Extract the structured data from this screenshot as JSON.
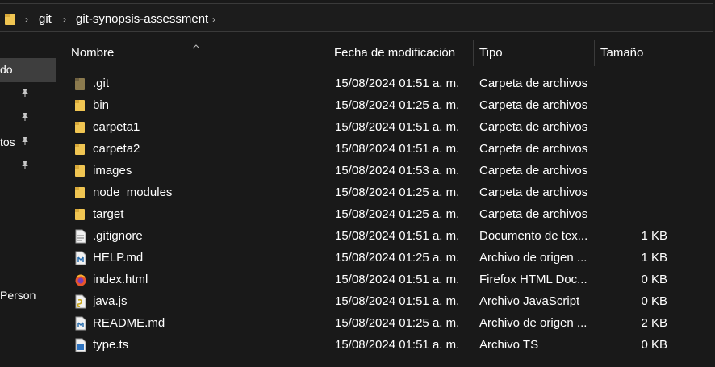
{
  "breadcrumb": {
    "items": [
      "git",
      "git-synopsis-assessment"
    ]
  },
  "nav": {
    "items": [
      {
        "label": "do",
        "selected": true
      },
      {
        "label": "",
        "pinned": true
      },
      {
        "label": "",
        "pinned": true
      },
      {
        "label": "tos",
        "pinned": true
      },
      {
        "label": "",
        "pinned": true
      },
      {
        "label": "Person"
      }
    ]
  },
  "columns": {
    "name": "Nombre",
    "date": "Fecha de modificación",
    "type": "Tipo",
    "size": "Tamaño"
  },
  "files": [
    {
      "name": ".git",
      "date": "15/08/2024 01:51 a. m.",
      "type": "Carpeta de archivos",
      "size": "",
      "icon": "folder-dim-icon"
    },
    {
      "name": "bin",
      "date": "15/08/2024 01:25 a. m.",
      "type": "Carpeta de archivos",
      "size": "",
      "icon": "folder-icon"
    },
    {
      "name": "carpeta1",
      "date": "15/08/2024 01:51 a. m.",
      "type": "Carpeta de archivos",
      "size": "",
      "icon": "folder-icon"
    },
    {
      "name": "carpeta2",
      "date": "15/08/2024 01:51 a. m.",
      "type": "Carpeta de archivos",
      "size": "",
      "icon": "folder-icon"
    },
    {
      "name": "images",
      "date": "15/08/2024 01:53 a. m.",
      "type": "Carpeta de archivos",
      "size": "",
      "icon": "folder-icon"
    },
    {
      "name": "node_modules",
      "date": "15/08/2024 01:25 a. m.",
      "type": "Carpeta de archivos",
      "size": "",
      "icon": "folder-icon"
    },
    {
      "name": "target",
      "date": "15/08/2024 01:25 a. m.",
      "type": "Carpeta de archivos",
      "size": "",
      "icon": "folder-icon"
    },
    {
      "name": ".gitignore",
      "date": "15/08/2024 01:51 a. m.",
      "type": "Documento de tex...",
      "size": "1 KB",
      "icon": "text-file-icon"
    },
    {
      "name": "HELP.md",
      "date": "15/08/2024 01:25 a. m.",
      "type": "Archivo de origen ...",
      "size": "1 KB",
      "icon": "markdown-file-icon"
    },
    {
      "name": "index.html",
      "date": "15/08/2024 01:51 a. m.",
      "type": "Firefox HTML Doc...",
      "size": "0 KB",
      "icon": "firefox-html-icon"
    },
    {
      "name": "java.js",
      "date": "15/08/2024 01:51 a. m.",
      "type": "Archivo JavaScript",
      "size": "0 KB",
      "icon": "javascript-file-icon"
    },
    {
      "name": "README.md",
      "date": "15/08/2024 01:25 a. m.",
      "type": "Archivo de origen ...",
      "size": "2 KB",
      "icon": "markdown-file-icon"
    },
    {
      "name": "type.ts",
      "date": "15/08/2024 01:51 a. m.",
      "type": "Archivo TS",
      "size": "0 KB",
      "icon": "typescript-file-icon"
    }
  ],
  "colors": {
    "background": "#191919",
    "folder": "#f0c552",
    "folder_dim": "#8b7a4e",
    "selection": "#3e3e3e"
  }
}
